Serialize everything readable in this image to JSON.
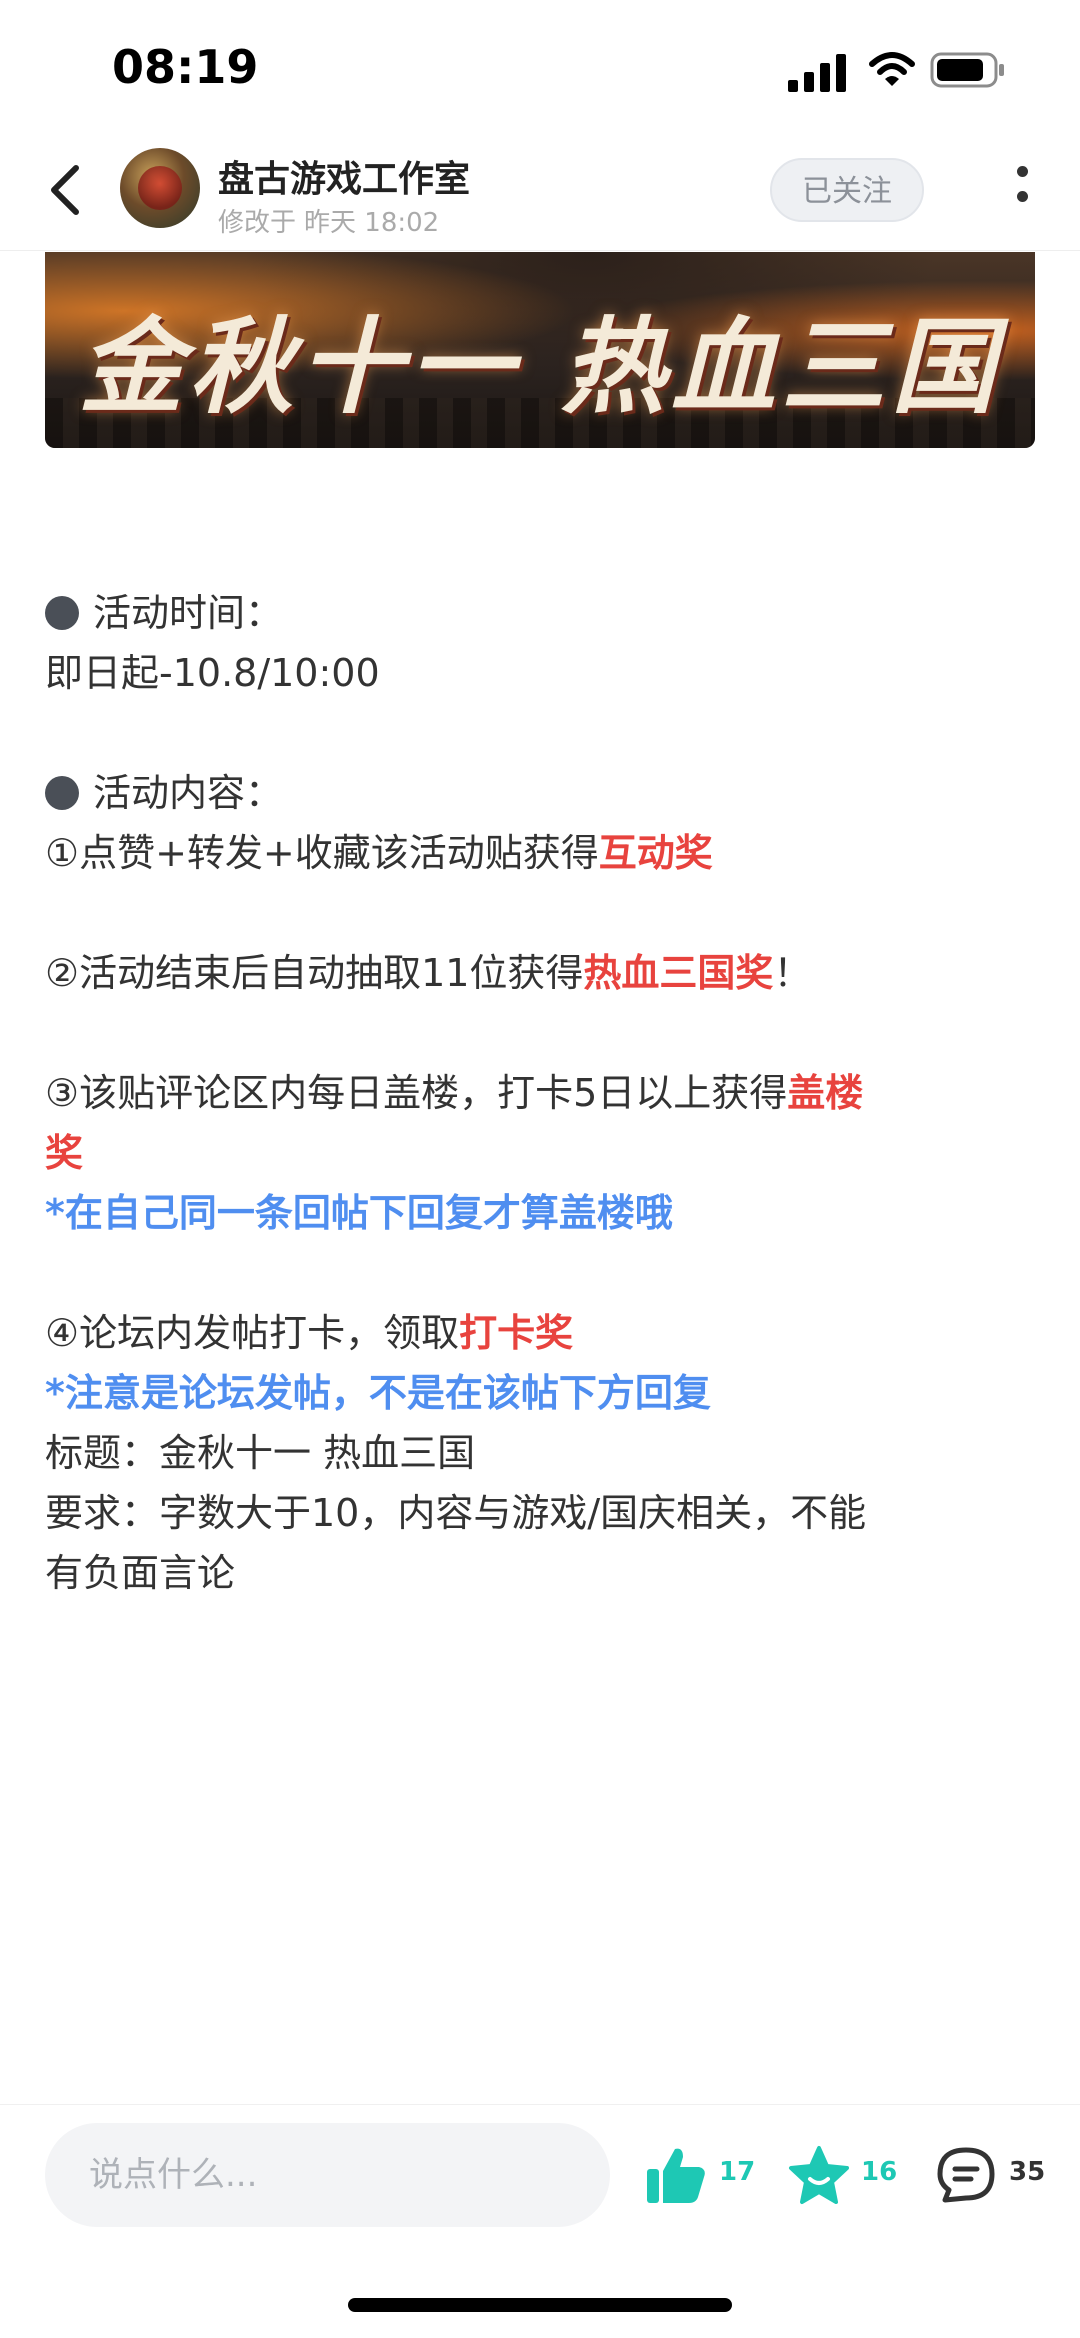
{
  "status_bar": {
    "time": "08:19"
  },
  "header": {
    "author_name": "盘古游戏工作室",
    "edit_prefix": "修改于",
    "edit_time": "昨天 18:02",
    "follow_label": "已关注"
  },
  "banner": {
    "title": "金秋十一 热血三国"
  },
  "article": {
    "section1_title": "活动时间：",
    "section1_value": "即日起-10.8/10:00",
    "section2_title": "活动内容：",
    "item1_text": "①点赞+转发+收藏该活动贴获得",
    "item1_award": "互动奖",
    "item2_text": "②活动结束后自动抽取11位获得",
    "item2_award": "热血三国奖",
    "item2_suffix": "！",
    "item3_text": "③该贴评论区内每日盖楼，打卡5日以上获得",
    "item3_award_a": "盖楼",
    "item3_award_b": "奖",
    "item3_note": "*在自己同一条回帖下回复才算盖楼哦",
    "item4_text": "④论坛内发帖打卡，领取",
    "item4_award": "打卡奖",
    "item4_note": "*注意是论坛发帖，不是在该帖下方回复",
    "title_line": "标题：金秋十一 热血三国",
    "req_line1": "要求：字数大于10，内容与游戏/国庆相关，不能",
    "req_line2": "有负面言论"
  },
  "bottom_bar": {
    "comment_placeholder": "说点什么...",
    "like_count": "17",
    "favorite_count": "16",
    "comment_count": "35"
  },
  "colors": {
    "accent_red": "#e8433e",
    "note_blue": "#4f8ef0",
    "action_teal": "#1ec8b4"
  }
}
